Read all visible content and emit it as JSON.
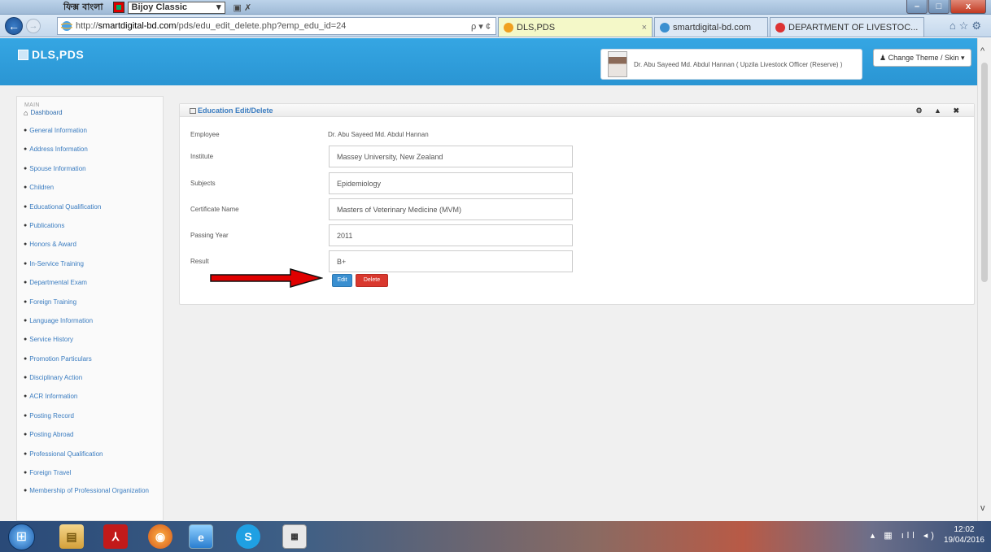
{
  "ime": {
    "bengali_text": "ফিক্স বাংলা",
    "keyboard": "Bijoy Classic",
    "keyboard_caret": "▾"
  },
  "window": {
    "minimize": "–",
    "maximize": "□",
    "close": "x"
  },
  "browser": {
    "url_prefix": "http://",
    "url_domain": "smartdigital-bd.com",
    "url_path": "/pds/edu_edit_delete.php?emp_edu_id=24",
    "address_tools": "ρ ▾ ¢",
    "tabs": [
      {
        "label": "DLS,PDS",
        "close": "×",
        "icon_color": "#f0a020"
      },
      {
        "label": "smartdigital-bd.com",
        "close": "",
        "icon_color": "#3a8fd0"
      },
      {
        "label": "DEPARTMENT OF LIVESTOC...",
        "close": "",
        "icon_color": "#d33"
      }
    ],
    "right_icons": "⌂☆⚙"
  },
  "header": {
    "logo_text": "DLS,PDS",
    "user_name": "Dr. Abu Sayeed Md. Abdul Hannan ( Upzila Livestock Officer (Reserve) )",
    "theme_button": "Change Theme / Skin",
    "theme_icon": "♟",
    "theme_caret": "▾"
  },
  "sidebar": {
    "title": "MAIN",
    "items": [
      {
        "label": "Dashboard",
        "icon": "home-icon"
      },
      {
        "label": "General Information",
        "icon": "globe-icon"
      },
      {
        "label": "Address Information",
        "icon": "globe-icon"
      },
      {
        "label": "Spouse Information",
        "icon": "globe-icon"
      },
      {
        "label": "Children",
        "icon": "globe-icon"
      },
      {
        "label": "Educational Qualification",
        "icon": "globe-icon"
      },
      {
        "label": "Publications",
        "icon": "globe-icon"
      },
      {
        "label": "Honors & Award",
        "icon": "globe-icon"
      },
      {
        "label": "In-Service Training",
        "icon": "globe-icon"
      },
      {
        "label": "Departmental Exam",
        "icon": "globe-icon"
      },
      {
        "label": "Foreign Training",
        "icon": "globe-icon"
      },
      {
        "label": "Language Information",
        "icon": "globe-icon"
      },
      {
        "label": "Service History",
        "icon": "globe-icon"
      },
      {
        "label": "Promotion Particulars",
        "icon": "globe-icon"
      },
      {
        "label": "Disciplinary Action",
        "icon": "globe-icon"
      },
      {
        "label": "ACR Information",
        "icon": "globe-icon"
      },
      {
        "label": "Posting Record",
        "icon": "globe-icon"
      },
      {
        "label": "Posting Abroad",
        "icon": "globe-icon"
      },
      {
        "label": "Professional Qualification",
        "icon": "globe-icon"
      },
      {
        "label": "Foreign Travel",
        "icon": "globe-icon"
      },
      {
        "label": "Membership of Professional Organization",
        "icon": "globe-icon"
      }
    ]
  },
  "panel": {
    "title": "Education Edit/Delete",
    "tools": "⚙ ▲ ✖"
  },
  "form": {
    "employee_label": "Employee",
    "employee_value": "Dr. Abu Sayeed Md. Abdul Hannan",
    "institute_label": "Institute",
    "institute_value": "Massey University, New Zealand",
    "subjects_label": "Subjects",
    "subjects_value": "Epidemiology",
    "certificate_label": "Certificate Name",
    "certificate_value": "Masters of Veterinary Medicine (MVM)",
    "year_label": "Passing Year",
    "year_value": "2011",
    "result_label": "Result",
    "result_value": "B+",
    "edit_label": "Edit",
    "delete_label": "Delete"
  },
  "taskbar": {
    "start": "⊞",
    "explorer": "▤",
    "acrobat": "⅄",
    "firefox": "◉",
    "ie": "e",
    "skype": "S",
    "app": "▦",
    "tray_icons": "▴ ▦ ıll ◂)",
    "time": "12:02",
    "date": "19/04/2016"
  },
  "colors": {
    "header_blue": "#2f9fdc",
    "link_blue": "#3a7cc0",
    "edit_blue": "#3a8fd0",
    "delete_red": "#d9382e",
    "arrow_red": "#e00000"
  }
}
